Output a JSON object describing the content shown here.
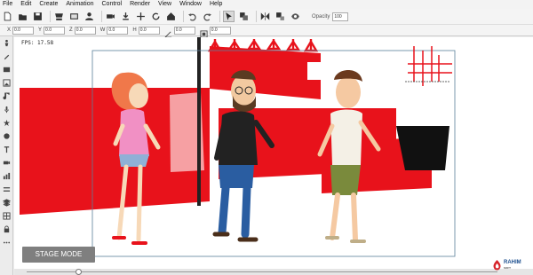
{
  "menu": [
    "File",
    "Edit",
    "Create",
    "Animation",
    "Control",
    "Render",
    "View",
    "Window",
    "Help"
  ],
  "toolbar": {
    "opacity_label": "Opacity",
    "opacity_value": "100",
    "icons": [
      "new-file-icon",
      "open-folder-icon",
      "save-icon",
      "store-icon",
      "library-icon",
      "actors-icon",
      "camera-icon",
      "import-icon",
      "move-icon",
      "rotate-icon",
      "home-icon",
      "undo-icon",
      "redo-icon",
      "select-icon",
      "copy-icon",
      "flip-icon",
      "arrange-icon",
      "visibility-icon"
    ]
  },
  "properties": {
    "x": {
      "label": "X",
      "value": "0.0"
    },
    "y": {
      "label": "Y",
      "value": "0.0"
    },
    "z": {
      "label": "Z",
      "value": "0.0"
    },
    "w": {
      "label": "W",
      "value": "0.0"
    },
    "h": {
      "label": "H",
      "value": "0.0"
    },
    "angle": {
      "label": "",
      "value": "0.0"
    },
    "scale": {
      "label": "",
      "value": "0.0"
    }
  },
  "stage": {
    "fps_text": "FPS: 17.58",
    "mode_button": "STAGE MODE"
  },
  "timeline": {
    "playhead_fraction": 0.11
  },
  "watermark": {
    "brand": "RAHIM",
    "sub": "SOFT"
  },
  "colors": {
    "accent_red": "#e8121b",
    "dark_red": "#b50d14",
    "shirt_pink": "#f190c4",
    "hair_orange": "#f0784a",
    "jeans_blue": "#2a5da1",
    "mode_gray": "#7f7f7f"
  }
}
